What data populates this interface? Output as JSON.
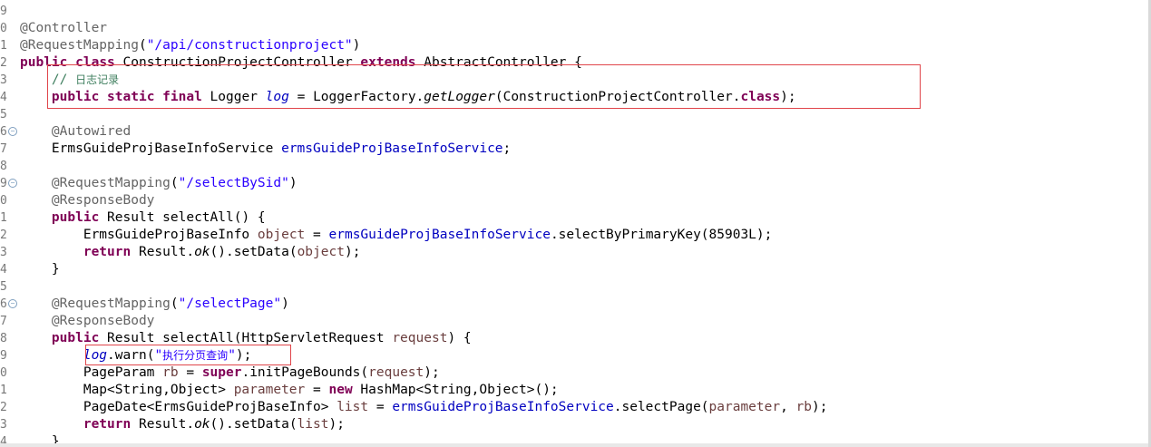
{
  "editor": {
    "language": "java",
    "lines": [
      {
        "num": "9",
        "fold": false,
        "tokens": []
      },
      {
        "num": "0",
        "fold": false,
        "tokens": [
          {
            "t": "@Controller",
            "c": "ann"
          }
        ]
      },
      {
        "num": "1",
        "fold": false,
        "tokens": [
          {
            "t": "@RequestMapping",
            "c": "ann"
          },
          {
            "t": "(",
            "c": ""
          },
          {
            "t": "\"/api/constructionproject\"",
            "c": "str"
          },
          {
            "t": ")",
            "c": ""
          }
        ]
      },
      {
        "num": "2",
        "fold": false,
        "tokens": [
          {
            "t": "public",
            "c": "kw"
          },
          {
            "t": " ",
            "c": ""
          },
          {
            "t": "class",
            "c": "kw"
          },
          {
            "t": " ConstructionProjectController ",
            "c": ""
          },
          {
            "t": "extends",
            "c": "kw"
          },
          {
            "t": " AbstractController {",
            "c": ""
          }
        ]
      },
      {
        "num": "3",
        "fold": false,
        "tokens": [
          {
            "t": "    // ",
            "c": "cmt"
          },
          {
            "t": "日志记录",
            "c": "cmt cjk"
          }
        ]
      },
      {
        "num": "4",
        "fold": false,
        "tokens": [
          {
            "t": "    ",
            "c": ""
          },
          {
            "t": "public",
            "c": "kw"
          },
          {
            "t": " ",
            "c": ""
          },
          {
            "t": "static",
            "c": "kw"
          },
          {
            "t": " ",
            "c": ""
          },
          {
            "t": "final",
            "c": "kw"
          },
          {
            "t": " Logger ",
            "c": ""
          },
          {
            "t": "log",
            "c": "sfld"
          },
          {
            "t": " = LoggerFactory.",
            "c": ""
          },
          {
            "t": "getLogger",
            "c": "ital"
          },
          {
            "t": "(ConstructionProjectController.",
            "c": ""
          },
          {
            "t": "class",
            "c": "kw"
          },
          {
            "t": ");",
            "c": ""
          }
        ]
      },
      {
        "num": "5",
        "fold": false,
        "tokens": []
      },
      {
        "num": "6",
        "fold": true,
        "tokens": [
          {
            "t": "    ",
            "c": ""
          },
          {
            "t": "@Autowired",
            "c": "ann"
          }
        ]
      },
      {
        "num": "7",
        "fold": false,
        "tokens": [
          {
            "t": "    ErmsGuideProjBaseInfoService ",
            "c": ""
          },
          {
            "t": "ermsGuideProjBaseInfoService",
            "c": "fld"
          },
          {
            "t": ";",
            "c": ""
          }
        ]
      },
      {
        "num": "8",
        "fold": false,
        "tokens": []
      },
      {
        "num": "9",
        "fold": true,
        "tokens": [
          {
            "t": "    ",
            "c": ""
          },
          {
            "t": "@RequestMapping",
            "c": "ann"
          },
          {
            "t": "(",
            "c": ""
          },
          {
            "t": "\"/selectBySid\"",
            "c": "str"
          },
          {
            "t": ")",
            "c": ""
          }
        ]
      },
      {
        "num": "0",
        "fold": false,
        "tokens": [
          {
            "t": "    ",
            "c": ""
          },
          {
            "t": "@ResponseBody",
            "c": "ann"
          }
        ]
      },
      {
        "num": "1",
        "fold": false,
        "tokens": [
          {
            "t": "    ",
            "c": ""
          },
          {
            "t": "public",
            "c": "kw"
          },
          {
            "t": " Result selectAll() {",
            "c": ""
          }
        ]
      },
      {
        "num": "2",
        "fold": false,
        "tokens": [
          {
            "t": "        ErmsGuideProjBaseInfo ",
            "c": ""
          },
          {
            "t": "object",
            "c": "var"
          },
          {
            "t": " = ",
            "c": ""
          },
          {
            "t": "ermsGuideProjBaseInfoService",
            "c": "fld"
          },
          {
            "t": ".selectByPrimaryKey(85903L);",
            "c": ""
          }
        ]
      },
      {
        "num": "3",
        "fold": false,
        "tokens": [
          {
            "t": "        ",
            "c": ""
          },
          {
            "t": "return",
            "c": "kw"
          },
          {
            "t": " Result.",
            "c": ""
          },
          {
            "t": "ok",
            "c": "ital"
          },
          {
            "t": "().setData(",
            "c": ""
          },
          {
            "t": "object",
            "c": "var"
          },
          {
            "t": ");",
            "c": ""
          }
        ]
      },
      {
        "num": "4",
        "fold": false,
        "tokens": [
          {
            "t": "    }",
            "c": ""
          }
        ]
      },
      {
        "num": "5",
        "fold": false,
        "tokens": []
      },
      {
        "num": "6",
        "fold": true,
        "tokens": [
          {
            "t": "    ",
            "c": ""
          },
          {
            "t": "@RequestMapping",
            "c": "ann"
          },
          {
            "t": "(",
            "c": ""
          },
          {
            "t": "\"/selectPage\"",
            "c": "str"
          },
          {
            "t": ")",
            "c": ""
          }
        ]
      },
      {
        "num": "7",
        "fold": false,
        "tokens": [
          {
            "t": "    ",
            "c": ""
          },
          {
            "t": "@ResponseBody",
            "c": "ann"
          }
        ]
      },
      {
        "num": "8",
        "fold": false,
        "tokens": [
          {
            "t": "    ",
            "c": ""
          },
          {
            "t": "public",
            "c": "kw"
          },
          {
            "t": " Result selectAll(HttpServletRequest ",
            "c": ""
          },
          {
            "t": "request",
            "c": "var"
          },
          {
            "t": ") {",
            "c": ""
          }
        ]
      },
      {
        "num": "9",
        "fold": false,
        "tokens": [
          {
            "t": "        ",
            "c": ""
          },
          {
            "t": "log",
            "c": "sfld"
          },
          {
            "t": ".warn(",
            "c": ""
          },
          {
            "t": "\"",
            "c": "str"
          },
          {
            "t": "执行分页查询",
            "c": "str cjk"
          },
          {
            "t": "\"",
            "c": "str"
          },
          {
            "t": ");",
            "c": ""
          }
        ]
      },
      {
        "num": "0",
        "fold": false,
        "tokens": [
          {
            "t": "        PageParam ",
            "c": ""
          },
          {
            "t": "rb",
            "c": "var"
          },
          {
            "t": " = ",
            "c": ""
          },
          {
            "t": "super",
            "c": "kw"
          },
          {
            "t": ".initPageBounds(",
            "c": ""
          },
          {
            "t": "request",
            "c": "var"
          },
          {
            "t": ");",
            "c": ""
          }
        ]
      },
      {
        "num": "1",
        "fold": false,
        "tokens": [
          {
            "t": "        Map<String,Object> ",
            "c": ""
          },
          {
            "t": "parameter",
            "c": "var"
          },
          {
            "t": " = ",
            "c": ""
          },
          {
            "t": "new",
            "c": "kw"
          },
          {
            "t": " HashMap<String,Object>();",
            "c": ""
          }
        ]
      },
      {
        "num": "2",
        "fold": false,
        "tokens": [
          {
            "t": "        PageDate<ErmsGuideProjBaseInfo> ",
            "c": ""
          },
          {
            "t": "list",
            "c": "var"
          },
          {
            "t": " = ",
            "c": ""
          },
          {
            "t": "ermsGuideProjBaseInfoService",
            "c": "fld"
          },
          {
            "t": ".selectPage(",
            "c": ""
          },
          {
            "t": "parameter",
            "c": "var"
          },
          {
            "t": ", ",
            "c": ""
          },
          {
            "t": "rb",
            "c": "var"
          },
          {
            "t": ");",
            "c": ""
          }
        ]
      },
      {
        "num": "3",
        "fold": false,
        "tokens": [
          {
            "t": "        ",
            "c": ""
          },
          {
            "t": "return",
            "c": "kw"
          },
          {
            "t": " Result.",
            "c": ""
          },
          {
            "t": "ok",
            "c": "ital"
          },
          {
            "t": "().setData(",
            "c": ""
          },
          {
            "t": "list",
            "c": "var"
          },
          {
            "t": ");",
            "c": ""
          }
        ]
      },
      {
        "num": "4",
        "fold": false,
        "tokens": [
          {
            "t": "    }",
            "c": ""
          }
        ]
      }
    ],
    "fold_glyph": "⊖",
    "colors": {
      "keyword": "#7f0055",
      "annotation": "#646464",
      "string": "#2a00ff",
      "comment": "#3f7f5f",
      "field": "#0000c0",
      "local_variable": "#6a3e3e",
      "highlight_box": "#e0454a"
    }
  }
}
